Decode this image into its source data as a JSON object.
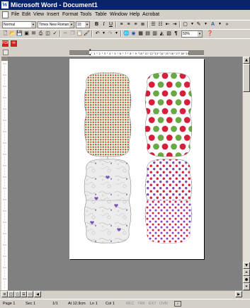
{
  "window": {
    "title": "Microsoft Word - Document1"
  },
  "menubar": {
    "items": [
      "File",
      "Edit",
      "View",
      "Insert",
      "Format",
      "Tools",
      "Table",
      "Window",
      "Help",
      "Acrobat"
    ]
  },
  "formatting_toolbar": {
    "style": "Normal",
    "font": "Times New Roman",
    "size": "10",
    "bold_label": "B",
    "italic_label": "I",
    "underline_label": "U"
  },
  "standard_toolbar": {
    "zoom": "50%"
  },
  "ruler": {
    "numbers": [
      "1",
      "2",
      "3",
      "4",
      "5",
      "6",
      "7",
      "8",
      "9",
      "10",
      "11",
      "12",
      "13",
      "14",
      "15",
      "16",
      "17",
      "18",
      "19"
    ]
  },
  "statusbar": {
    "page": "Page 1",
    "section": "Sec 1",
    "pages": "1/1",
    "at": "At 12.9cm",
    "line": "Ln 1",
    "col": "Col 1",
    "rec": "REC",
    "trk": "TRK",
    "ext": "EXT",
    "ovr": "OVR"
  },
  "document": {
    "patterns": [
      {
        "name": "small-red-green-dots",
        "colors": [
          "#d53a3a",
          "#5aa04a"
        ]
      },
      {
        "name": "big-red-green-dots",
        "colors": [
          "#d61f3c",
          "#6aa845"
        ]
      },
      {
        "name": "grey-floral-purple",
        "colors": [
          "#b8b8b8",
          "#7a55b5"
        ]
      },
      {
        "name": "red-purple-dots",
        "colors": [
          "#d61f3c",
          "#7a48b0"
        ]
      }
    ]
  }
}
